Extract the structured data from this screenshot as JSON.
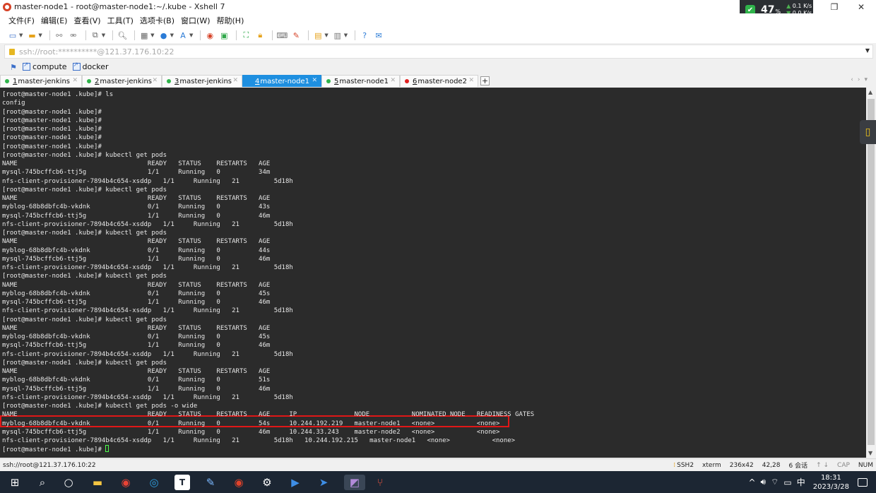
{
  "window": {
    "title": "master-node1 - root@master-node1:~/.kube - Xshell 7",
    "minimize": "—",
    "maximize": "❐",
    "close": "✕"
  },
  "net_widget": {
    "percent": "47",
    "percent_sign": "%",
    "up": "0.1 K/s",
    "down": "0.0 K/s"
  },
  "menu": [
    "文件(F)",
    "编辑(E)",
    "查看(V)",
    "工具(T)",
    "选项卡(B)",
    "窗口(W)",
    "帮助(H)"
  ],
  "address": {
    "text": "ssh://root:**********@121.37.176.10:22"
  },
  "links": [
    "compute",
    "docker"
  ],
  "tabs": [
    {
      "num": "1",
      "label": " master-jenkins",
      "dot": "#2fb34a",
      "active": false
    },
    {
      "num": "2",
      "label": " master-jenkins",
      "dot": "#2fb34a",
      "active": false
    },
    {
      "num": "3",
      "label": " master-jenkins",
      "dot": "#2fb34a",
      "active": false
    },
    {
      "num": "4",
      "label": " master-node1",
      "dot": "#1e8fe0",
      "active": true
    },
    {
      "num": "5",
      "label": " master-node1",
      "dot": "#2fb34a",
      "active": false
    },
    {
      "num": "6",
      "label": " master-node2",
      "dot": "#e02020",
      "active": false
    }
  ],
  "terminal": {
    "lines": [
      "[root@master-node1 .kube]# ls",
      "config",
      "[root@master-node1 .kube]#",
      "[root@master-node1 .kube]#",
      "[root@master-node1 .kube]#",
      "[root@master-node1 .kube]#",
      "[root@master-node1 .kube]#",
      "[root@master-node1 .kube]# kubectl get pods",
      "NAME                                  READY   STATUS    RESTARTS   AGE",
      "mysql-745bcffcb6-ttj5g                1/1     Running   0          34m",
      "nfs-client-provisioner-7894b4c654-xsddp   1/1     Running   21         5d18h",
      "[root@master-node1 .kube]# kubectl get pods",
      "NAME                                  READY   STATUS    RESTARTS   AGE",
      "myblog-68b8dbfc4b-vkdnk               0/1     Running   0          43s",
      "mysql-745bcffcb6-ttj5g                1/1     Running   0          46m",
      "nfs-client-provisioner-7894b4c654-xsddp   1/1     Running   21         5d18h",
      "[root@master-node1 .kube]# kubectl get pods",
      "NAME                                  READY   STATUS    RESTARTS   AGE",
      "myblog-68b8dbfc4b-vkdnk               0/1     Running   0          44s",
      "mysql-745bcffcb6-ttj5g                1/1     Running   0          46m",
      "nfs-client-provisioner-7894b4c654-xsddp   1/1     Running   21         5d18h",
      "[root@master-node1 .kube]# kubectl get pods",
      "NAME                                  READY   STATUS    RESTARTS   AGE",
      "myblog-68b8dbfc4b-vkdnk               0/1     Running   0          45s",
      "mysql-745bcffcb6-ttj5g                1/1     Running   0          46m",
      "nfs-client-provisioner-7894b4c654-xsddp   1/1     Running   21         5d18h",
      "[root@master-node1 .kube]# kubectl get pods",
      "NAME                                  READY   STATUS    RESTARTS   AGE",
      "myblog-68b8dbfc4b-vkdnk               0/1     Running   0          45s",
      "mysql-745bcffcb6-ttj5g                1/1     Running   0          46m",
      "nfs-client-provisioner-7894b4c654-xsddp   1/1     Running   21         5d18h",
      "[root@master-node1 .kube]# kubectl get pods",
      "NAME                                  READY   STATUS    RESTARTS   AGE",
      "myblog-68b8dbfc4b-vkdnk               0/1     Running   0          51s",
      "mysql-745bcffcb6-ttj5g                1/1     Running   0          46m",
      "nfs-client-provisioner-7894b4c654-xsddp   1/1     Running   21         5d18h",
      "[root@master-node1 .kube]# kubectl get pods -o wide",
      "NAME                                  READY   STATUS    RESTARTS   AGE     IP               NODE           NOMINATED NODE   READINESS GATES",
      "myblog-68b8dbfc4b-vkdnk               0/1     Running   0          54s     10.244.192.219   master-node1   <none>           <none>",
      "mysql-745bcffcb6-ttj5g                1/1     Running   0          46m     10.244.33.243    master-node2   <none>           <none>",
      "nfs-client-provisioner-7894b4c654-xsddp   1/1     Running   21         5d18h   10.244.192.215   master-node1   <none>           <none>",
      "[root@master-node1 .kube]# "
    ]
  },
  "status": {
    "address": "ssh://root@121.37.176.10:22",
    "protocol": "SSH2",
    "term": "xterm",
    "size": "236x42",
    "pos": "42,28",
    "sessions": "6 会话",
    "caps": "CAP",
    "num": "NUM"
  },
  "taskbar": {
    "clock_time": "18:31",
    "clock_date": "2023/3/28",
    "ime": "中"
  }
}
